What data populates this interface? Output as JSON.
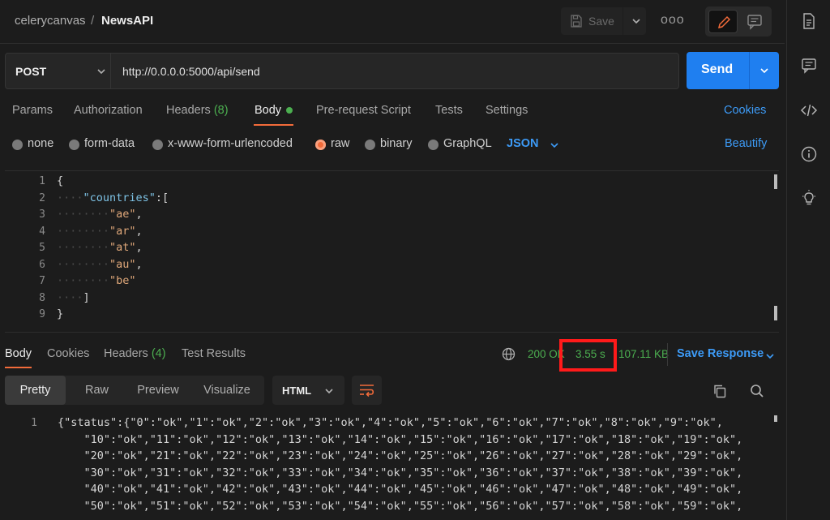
{
  "breadcrumb": {
    "workspace": "celerycanvas",
    "separator": "/",
    "request_name": "NewsAPI"
  },
  "toolbar": {
    "save_label": "Save",
    "more_label": "ooo"
  },
  "request": {
    "method": "POST",
    "url": "http://0.0.0.0:5000/api/send",
    "send_label": "Send"
  },
  "request_tabs": {
    "params": "Params",
    "authorization": "Authorization",
    "headers": "Headers",
    "headers_count": "(8)",
    "body": "Body",
    "pre_request": "Pre-request Script",
    "tests": "Tests",
    "settings": "Settings",
    "cookies": "Cookies"
  },
  "body_types": {
    "none": "none",
    "form_data": "form-data",
    "urlencoded": "x-www-form-urlencoded",
    "raw": "raw",
    "binary": "binary",
    "graphql": "GraphQL",
    "format": "JSON",
    "beautify": "Beautify",
    "selected": "raw"
  },
  "editor": {
    "line_numbers": [
      "1",
      "2",
      "3",
      "4",
      "5",
      "6",
      "7",
      "8",
      "9"
    ],
    "lines": {
      "l1": "{",
      "l2_key": "\"countries\"",
      "l2_rest": ":[",
      "l3": "\"ae\"",
      "l4": "\"ar\"",
      "l5": "\"at\"",
      "l6": "\"au\"",
      "l7": "\"be\"",
      "l8": "]",
      "l9": "}"
    }
  },
  "response_tabs": {
    "body": "Body",
    "cookies": "Cookies",
    "headers": "Headers",
    "headers_count": "(4)",
    "test_results": "Test Results"
  },
  "response_meta": {
    "status": "200 OK",
    "time": "3.55 s",
    "size": "107.11 KB",
    "save_response": "Save Response"
  },
  "response_format": {
    "pretty": "Pretty",
    "raw": "Raw",
    "preview": "Preview",
    "visualize": "Visualize",
    "language": "HTML"
  },
  "response_body": {
    "line_number": "1",
    "lines": [
      "{\"status\":{\"0\":\"ok\",\"1\":\"ok\",\"2\":\"ok\",\"3\":\"ok\",\"4\":\"ok\",\"5\":\"ok\",\"6\":\"ok\",\"7\":\"ok\",\"8\":\"ok\",\"9\":\"ok\",",
      "    \"10\":\"ok\",\"11\":\"ok\",\"12\":\"ok\",\"13\":\"ok\",\"14\":\"ok\",\"15\":\"ok\",\"16\":\"ok\",\"17\":\"ok\",\"18\":\"ok\",\"19\":\"ok\",",
      "    \"20\":\"ok\",\"21\":\"ok\",\"22\":\"ok\",\"23\":\"ok\",\"24\":\"ok\",\"25\":\"ok\",\"26\":\"ok\",\"27\":\"ok\",\"28\":\"ok\",\"29\":\"ok\",",
      "    \"30\":\"ok\",\"31\":\"ok\",\"32\":\"ok\",\"33\":\"ok\",\"34\":\"ok\",\"35\":\"ok\",\"36\":\"ok\",\"37\":\"ok\",\"38\":\"ok\",\"39\":\"ok\",",
      "    \"40\":\"ok\",\"41\":\"ok\",\"42\":\"ok\",\"43\":\"ok\",\"44\":\"ok\",\"45\":\"ok\",\"46\":\"ok\",\"47\":\"ok\",\"48\":\"ok\",\"49\":\"ok\",",
      "    \"50\":\"ok\",\"51\":\"ok\",\"52\":\"ok\",\"53\":\"ok\",\"54\":\"ok\",\"55\":\"ok\",\"56\":\"ok\",\"57\":\"ok\",\"58\":\"ok\",\"59\":\"ok\","
    ]
  },
  "colors": {
    "accent_blue": "#1f7ff0",
    "link_blue": "#3d9bf7",
    "success_green": "#4caf50",
    "active_orange": "#f26b3a",
    "highlight_red": "#ff1a1a"
  },
  "icons": {
    "save": "save-icon",
    "edit": "pencil-icon",
    "comment": "comment-icon",
    "documentation": "document-icon",
    "comments": "comment-icon",
    "code": "code-icon",
    "info": "info-icon",
    "lightbulb": "lightbulb-icon",
    "globe": "globe-icon",
    "wrap": "wrap-lines-icon",
    "copy": "copy-icon",
    "search": "search-icon"
  }
}
